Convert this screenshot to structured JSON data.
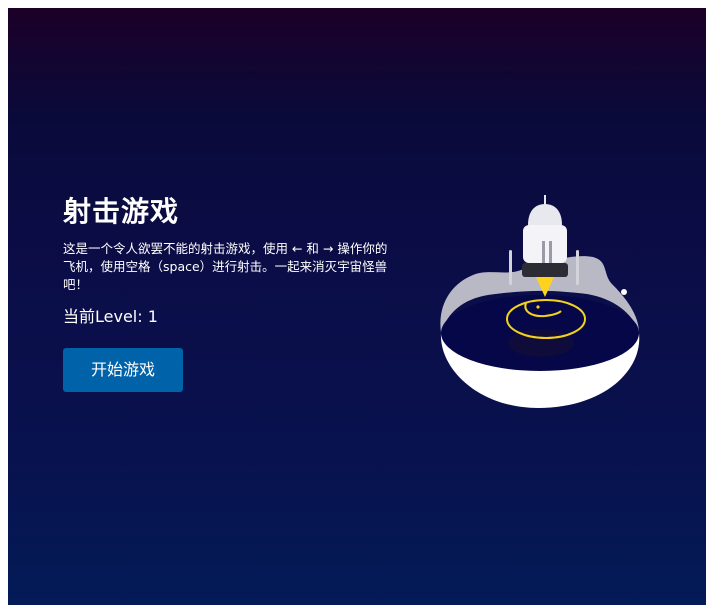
{
  "game": {
    "title": "射击游戏",
    "description": "这是一个令人欲罢不能的射击游戏，使用 ← 和 → 操作你的飞机，使用空格（space）进行射击。一起来消灭宇宙怪兽吧！",
    "level_text": "当前Level: 1",
    "start_button": "开始游戏"
  },
  "colors": {
    "accent_button": "#0062a8",
    "background_top": "#1c0028",
    "background_bottom": "#031b57",
    "flame": "#ffd21e"
  },
  "illustration": {
    "icon": "rocket-launch-icon"
  }
}
